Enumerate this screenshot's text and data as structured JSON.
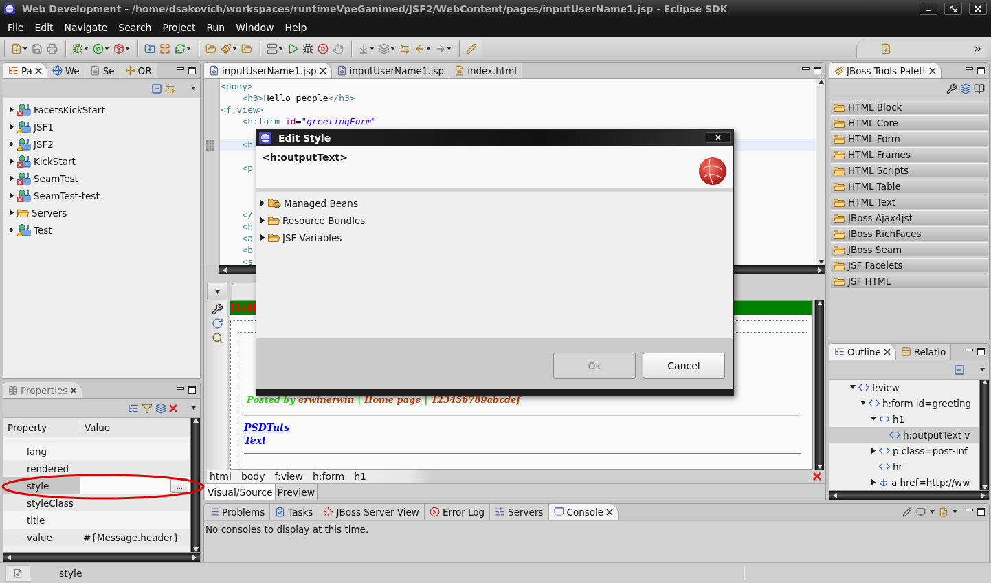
{
  "window": {
    "title": "Web Development - /home/dsakovich/workspaces/runtimeVpeGanimed/JSF2/WebContent/pages/inputUserName1.jsp - Eclipse SDK"
  },
  "menu": [
    "File",
    "Edit",
    "Navigate",
    "Search",
    "Project",
    "Run",
    "Window",
    "Help"
  ],
  "explorer": {
    "tabs": [
      {
        "label": "Pa",
        "kind": "packages",
        "selected": true
      },
      {
        "label": "We",
        "kind": "web",
        "selected": false
      },
      {
        "label": "Se",
        "kind": "snippets",
        "selected": false
      },
      {
        "label": "OR",
        "kind": "or",
        "selected": false
      }
    ],
    "items": [
      {
        "label": "FacetsKickStart",
        "kind": "error",
        "expanded": false
      },
      {
        "label": "JSF1",
        "kind": "warning",
        "expanded": false
      },
      {
        "label": "JSF2",
        "kind": "warning",
        "expanded": false
      },
      {
        "label": "KickStart",
        "kind": "error",
        "expanded": false
      },
      {
        "label": "SeamTest",
        "kind": "error",
        "expanded": false
      },
      {
        "label": "SeamTest-test",
        "kind": "error",
        "expanded": false
      },
      {
        "label": "Servers",
        "kind": "folder",
        "expanded": false
      },
      {
        "label": "Test",
        "kind": "warning",
        "expanded": false
      }
    ]
  },
  "properties": {
    "tab": "Properties",
    "columns": [
      "Property",
      "Value"
    ],
    "rows": [
      {
        "property": "lang",
        "selected": false
      },
      {
        "property": "rendered",
        "selected": false
      },
      {
        "property": "style",
        "selected": true,
        "action": "..."
      },
      {
        "property": "styleClass",
        "selected": false
      },
      {
        "property": "title",
        "selected": false
      },
      {
        "property": "value",
        "value": "#{Message.header}",
        "selected": false
      }
    ]
  },
  "editor": {
    "tabs": [
      {
        "label": "inputUserName1.jsp",
        "kind": "jsp",
        "selected": true
      },
      {
        "label": "inputUserName1.jsp",
        "kind": "jsp",
        "selected": false
      },
      {
        "label": "index.html",
        "kind": "html",
        "selected": false
      }
    ],
    "code": [
      {
        "kind": "code",
        "current": false,
        "parts": [
          {
            "kind": "tag",
            "text": "<body>"
          }
        ]
      },
      {
        "kind": "code",
        "current": false,
        "parts": [
          {
            "kind": "tag",
            "text": "    <h3>"
          },
          {
            "kind": "text",
            "text": "Hello people"
          },
          {
            "kind": "tag",
            "text": "</h3>"
          }
        ]
      },
      {
        "kind": "code",
        "current": false,
        "parts": [
          {
            "kind": "tag",
            "text": "<f:view>"
          }
        ]
      },
      {
        "kind": "code",
        "current": false,
        "parts": [
          {
            "kind": "tag",
            "text": "    <h:form "
          },
          {
            "kind": "attr",
            "text": "id"
          },
          {
            "kind": "text",
            "text": "="
          },
          {
            "kind": "value",
            "text": "\"greetingForm\""
          }
        ]
      },
      {
        "kind": "blank",
        "current": false
      },
      {
        "kind": "code",
        "current": true,
        "parts": [
          {
            "kind": "tag",
            "text": "    <h"
          }
        ]
      },
      {
        "kind": "blank",
        "current": false
      },
      {
        "kind": "code",
        "current": false,
        "parts": [
          {
            "kind": "tag",
            "text": "    <p"
          }
        ]
      },
      {
        "kind": "blank",
        "current": false
      },
      {
        "kind": "blank",
        "current": false
      },
      {
        "kind": "blank",
        "current": false
      },
      {
        "kind": "code",
        "current": false,
        "parts": [
          {
            "kind": "tag",
            "text": "    </"
          }
        ]
      },
      {
        "kind": "code",
        "current": false,
        "parts": [
          {
            "kind": "tag",
            "text": "    <h"
          }
        ]
      },
      {
        "kind": "code",
        "current": false,
        "parts": [
          {
            "kind": "tag",
            "text": "    <a"
          }
        ]
      },
      {
        "kind": "code",
        "current": false,
        "parts": [
          {
            "kind": "tag",
            "text": "    <b"
          }
        ]
      },
      {
        "kind": "code",
        "current": false,
        "parts": [
          {
            "kind": "tag",
            "text": "    <s"
          }
        ]
      }
    ],
    "visual": {
      "banner": "Hell",
      "byline": [
        {
          "kind": "label",
          "text": "Posted by"
        },
        {
          "kind": "link",
          "text": "erwinerwin"
        },
        {
          "kind": "sep",
          "text": "|"
        },
        {
          "kind": "link",
          "text": "Home page"
        },
        {
          "kind": "sep",
          "text": "|"
        },
        {
          "kind": "link",
          "text": "123456789abcdef"
        }
      ],
      "links": [
        "PSDTuts",
        "Text"
      ]
    },
    "breadcrumb": [
      "html",
      "body",
      "f:view",
      "h:form",
      "h1"
    ],
    "mode_tabs": [
      {
        "label": "Visual/Source",
        "selected": true
      },
      {
        "label": "Preview",
        "selected": false
      }
    ]
  },
  "palette": {
    "tab": "JBoss Tools Palett",
    "groups": [
      "HTML Block",
      "HTML Core",
      "HTML Form",
      "HTML Frames",
      "HTML Scripts",
      "HTML Table",
      "HTML Text",
      "JBoss Ajax4jsf",
      "JBoss RichFaces",
      "JBoss Seam",
      "JSF Facelets",
      "JSF HTML"
    ]
  },
  "outline": {
    "tabs": [
      {
        "label": "Outline",
        "kind": "outline",
        "selected": true
      },
      {
        "label": "Relatio",
        "kind": "relations",
        "selected": false
      }
    ],
    "tree": [
      {
        "label": "f:view",
        "kind": "tag",
        "expandable": true,
        "expanded": true,
        "selected": false,
        "children": [
          {
            "label": "h:form id=greeting",
            "kind": "tag",
            "expandable": true,
            "expanded": true,
            "selected": false,
            "children": [
              {
                "label": "h1",
                "kind": "tag",
                "expandable": true,
                "expanded": true,
                "selected": false,
                "children": [
                  {
                    "label": "h:outputText v",
                    "kind": "tag",
                    "expandable": false,
                    "expanded": false,
                    "selected": true
                  }
                ]
              },
              {
                "label": "p class=post-inf",
                "kind": "tag",
                "expandable": true,
                "expanded": false,
                "selected": false
              },
              {
                "label": "hr",
                "kind": "tag",
                "expandable": false,
                "expanded": false,
                "selected": false
              },
              {
                "label": "a href=http://ww",
                "kind": "anchor",
                "expandable": true,
                "expanded": false,
                "selected": false
              }
            ]
          }
        ]
      }
    ]
  },
  "console": {
    "tabs": [
      {
        "label": "Problems",
        "kind": "problems",
        "selected": false
      },
      {
        "label": "Tasks",
        "kind": "tasks",
        "selected": false
      },
      {
        "label": "JBoss Server View",
        "kind": "jboss",
        "selected": false
      },
      {
        "label": "Error Log",
        "kind": "errors",
        "selected": false
      },
      {
        "label": "Servers",
        "kind": "servers",
        "selected": false
      },
      {
        "label": "Console",
        "kind": "console",
        "selected": true
      }
    ],
    "message": "No consoles to display at this time."
  },
  "status_bar": {
    "text": "style"
  },
  "dialog": {
    "title": "Edit Style",
    "element": "<h:outputText>",
    "tree": [
      {
        "label": "Managed Beans",
        "kind": "beans",
        "expanded": false
      },
      {
        "label": "Resource Bundles",
        "kind": "folder",
        "expanded": false
      },
      {
        "label": "JSF Variables",
        "kind": "folder",
        "expanded": false
      }
    ],
    "buttons": [
      {
        "label": "Ok",
        "disabled": true
      },
      {
        "label": "Cancel",
        "disabled": false
      }
    ]
  }
}
